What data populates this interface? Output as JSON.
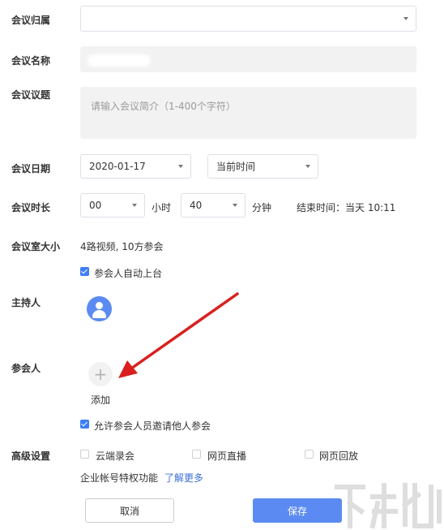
{
  "form": {
    "labels": {
      "org": "会议归属",
      "name": "会议名称",
      "agenda": "会议议题",
      "date": "会议日期",
      "duration": "会议时长",
      "room_size": "会议室大小",
      "host": "主持人",
      "participants": "参会人",
      "advanced": "高级设置"
    },
    "org_select": {
      "value": ""
    },
    "agenda_input": {
      "placeholder": "请输入会议简介（1-400个字符）"
    },
    "date_select": {
      "value": "2020-01-17"
    },
    "time_select": {
      "value": "当前时间"
    },
    "hours_select": {
      "value": "00"
    },
    "hours_unit": "小时",
    "minutes_select": {
      "value": "40"
    },
    "minutes_unit": "分钟",
    "end_time": "结束时间：当天 10:11",
    "room_size_value": "4路视频, 10方参会",
    "auto_stage": {
      "label": "参会人自动上台",
      "checked": true
    },
    "add_participant_label": "添加",
    "add_participant_icon": "plus-icon",
    "allow_invite": {
      "label": "允许参会人员邀请他人参会",
      "checked": true
    },
    "advanced_options": [
      {
        "label": "云端录会",
        "checked": false
      },
      {
        "label": "网页直播",
        "checked": false
      },
      {
        "label": "网页回放",
        "checked": false
      }
    ],
    "enterprise_note": "企业帐号特权功能",
    "learn_more": "了解更多"
  },
  "buttons": {
    "cancel": "取消",
    "save": "保存"
  },
  "colors": {
    "accent": "#5b8bf2",
    "checkbox": "#3d7ef7",
    "link": "#3a6fd8",
    "arrow": "#d9201f"
  }
}
